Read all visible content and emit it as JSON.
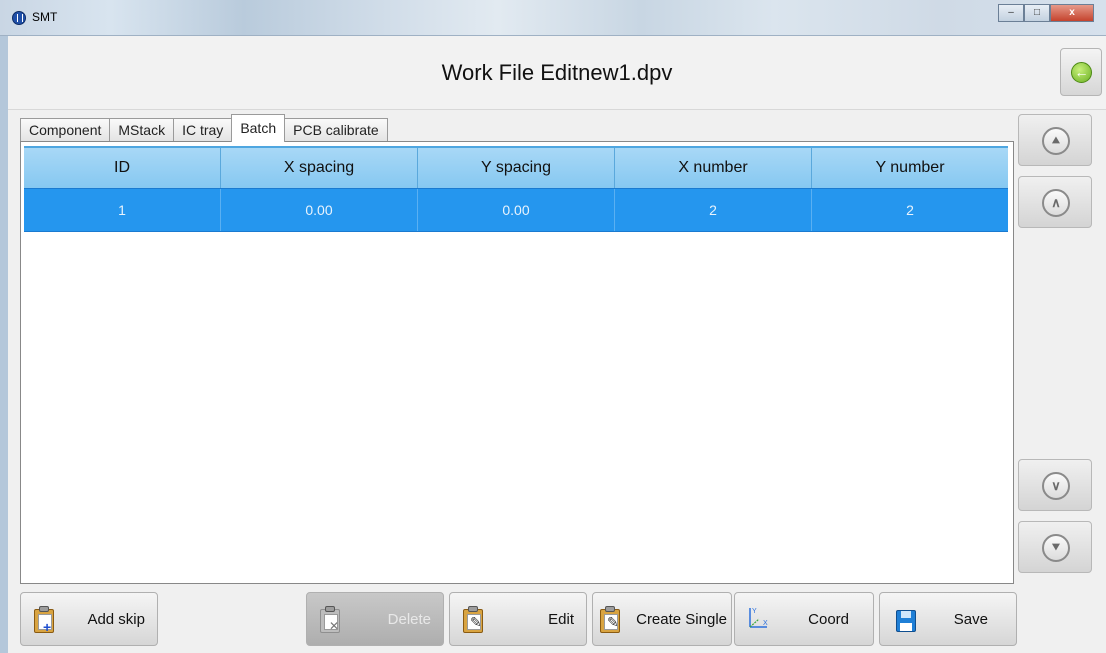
{
  "window": {
    "title": "SMT",
    "minimize": "–",
    "maximize": "□",
    "close": "x"
  },
  "header": {
    "title": "Work File Editnew1.dpv",
    "back_icon": "left-arrow-icon"
  },
  "tabs": [
    {
      "label": "Component",
      "active": false
    },
    {
      "label": "MStack",
      "active": false
    },
    {
      "label": "IC tray",
      "active": false
    },
    {
      "label": "Batch",
      "active": true
    },
    {
      "label": "PCB calibrate",
      "active": false
    }
  ],
  "table": {
    "columns": [
      "ID",
      "X spacing",
      "Y spacing",
      "X number",
      "Y number"
    ],
    "rows": [
      {
        "id": "1",
        "x_spacing": "0.00",
        "y_spacing": "0.00",
        "x_number": "2",
        "y_number": "2",
        "selected": true
      }
    ]
  },
  "scroll": {
    "top": "double-chevron-up-icon",
    "up": "chevron-up-icon",
    "down": "chevron-down-icon",
    "bottom": "double-chevron-down-icon"
  },
  "toolbar": {
    "add_skip": "Add skip",
    "delete": "Delete",
    "edit": "Edit",
    "create_single": "Create Single",
    "coord": "Coord",
    "save": "Save"
  },
  "colors": {
    "header_gradient_top": "#a8d8f6",
    "selected_row": "#2596ee",
    "back_icon": "#6ab023"
  }
}
